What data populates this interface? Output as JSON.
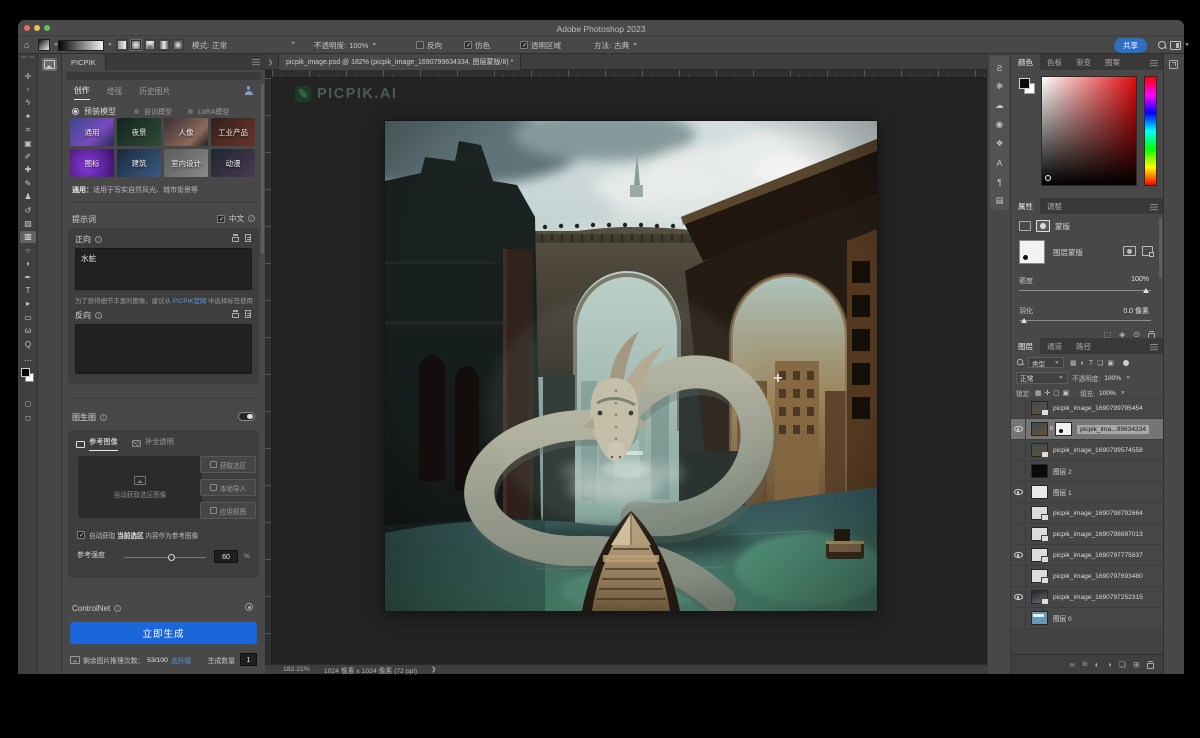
{
  "window": {
    "title": "Adobe Photoshop 2023"
  },
  "options": {
    "mode_label": "模式:",
    "mode_value": "正常",
    "opacity_label": "不透明度:",
    "opacity_value": "100%",
    "reverse_label": "反向",
    "dither_label": "仿色",
    "transparency_label": "透明区域",
    "method_label": "方法:",
    "method_value": "古典",
    "share_label": "共享"
  },
  "toolbar": {
    "tools": [
      "✛",
      "▫",
      "ϟ",
      "✦",
      "⌗",
      "▣",
      "✐",
      "✚",
      "✎",
      "♟",
      "↺",
      "▨",
      "▥",
      "○",
      "◖",
      "✒",
      "T",
      "▸",
      "▭",
      "ω",
      "Q"
    ],
    "more": "⋯",
    "selected_index": 12
  },
  "doc": {
    "tab_title": "picpik_image.psd @ 182% (picpik_image_1690799634334, 图层蒙版/8) *",
    "status_zoom": "182.21%",
    "status_dims": "1024 像素 x 1024 像素 (72 ppi)",
    "status_more": "❯",
    "canvas_logo": "PICPIK.AI"
  },
  "picpik": {
    "panel_title": "PICPIK",
    "tabs": [
      "创作",
      "增强",
      "历史图片"
    ],
    "model_radio": "预装模型",
    "model_options": [
      "自训模型",
      "LoRA模型"
    ],
    "models": [
      "通用",
      "夜景",
      "人像",
      "工业产品",
      "图标",
      "建筑",
      "室内设计",
      "动漫"
    ],
    "model_desc_prefix": "通用：",
    "model_desc": "适用于写实自然风光、城市街景等",
    "prompt_header": "提示词",
    "lang_label": "中文",
    "positive_label": "正向",
    "positive_value": "水蛇",
    "tip_pre": "为了获得细节丰富的图像，建议从 ",
    "tip_link": "PICPIK官网",
    "tip_post": " 中选择标签使用",
    "negative_label": "反向",
    "img2img_label": "图生图",
    "ref_tab1": "参考图像",
    "ref_tab2": "补全透明",
    "drop_hint": "自动获取选区图像",
    "ref_buttons": [
      "获取选区",
      "本地导入",
      "应用抠图"
    ],
    "auto_pre": "自动获取 ",
    "auto_mid": "当前选区",
    "auto_post": " 内容作为参考图像",
    "strength_label": "参考强度",
    "strength_value": "60",
    "strength_unit": "%",
    "controlnet_label": "ControlNet",
    "generate_label": "立即生成",
    "quota_label": "剩余图片推理次数：",
    "quota_value": "53/100",
    "upgrade_link": "去升级",
    "count_label": "生成数量",
    "count_value": "1"
  },
  "color_panel": {
    "tabs": [
      "颜色",
      "色板",
      "渐变",
      "图案"
    ]
  },
  "props_panel": {
    "tabs": [
      "属性",
      "调整"
    ],
    "mask_header": "蒙版",
    "mask_name": "图层蒙版",
    "density_label": "密度",
    "density_value": "100%",
    "feather_label": "羽化",
    "feather_value": "0.0 像素"
  },
  "layers_panel": {
    "tabs": [
      "图层",
      "通道",
      "路径"
    ],
    "filter_label": "类型",
    "blend_mode": "正常",
    "opacity_label": "不透明度:",
    "opacity_value": "100%",
    "lock_label": "锁定:",
    "fill_label": "填充:",
    "fill_value": "100%",
    "layers": [
      {
        "name": "picpik_image_1690799795454",
        "eye": false,
        "thumb": "art",
        "selected": false
      },
      {
        "name": "picpik_ima...99634334",
        "eye": true,
        "thumb": "maskrow",
        "selected": true
      },
      {
        "name": "picpik_image_1690799574558",
        "eye": false,
        "thumb": "art",
        "selected": false
      },
      {
        "name": "图层 2",
        "eye": false,
        "thumb": "black",
        "selected": false
      },
      {
        "name": "图层 1",
        "eye": true,
        "thumb": "white",
        "selected": false
      },
      {
        "name": "picpik_image_1690798792664",
        "eye": false,
        "thumb": "light",
        "selected": false
      },
      {
        "name": "picpik_image_1690798697013",
        "eye": false,
        "thumb": "light",
        "selected": false
      },
      {
        "name": "picpik_image_1690797775837",
        "eye": true,
        "thumb": "light",
        "selected": false
      },
      {
        "name": "picpik_image_1690797693480",
        "eye": false,
        "thumb": "light",
        "selected": false
      },
      {
        "name": "picpik_image_1690797252315",
        "eye": true,
        "thumb": "photo",
        "selected": false
      },
      {
        "name": "图层 0",
        "eye": false,
        "thumb": "blue",
        "selected": false
      }
    ]
  },
  "dock_icons": [
    "Ƨ",
    "❋",
    "☁",
    "◉",
    "❖",
    "A",
    "¶",
    "▤"
  ]
}
